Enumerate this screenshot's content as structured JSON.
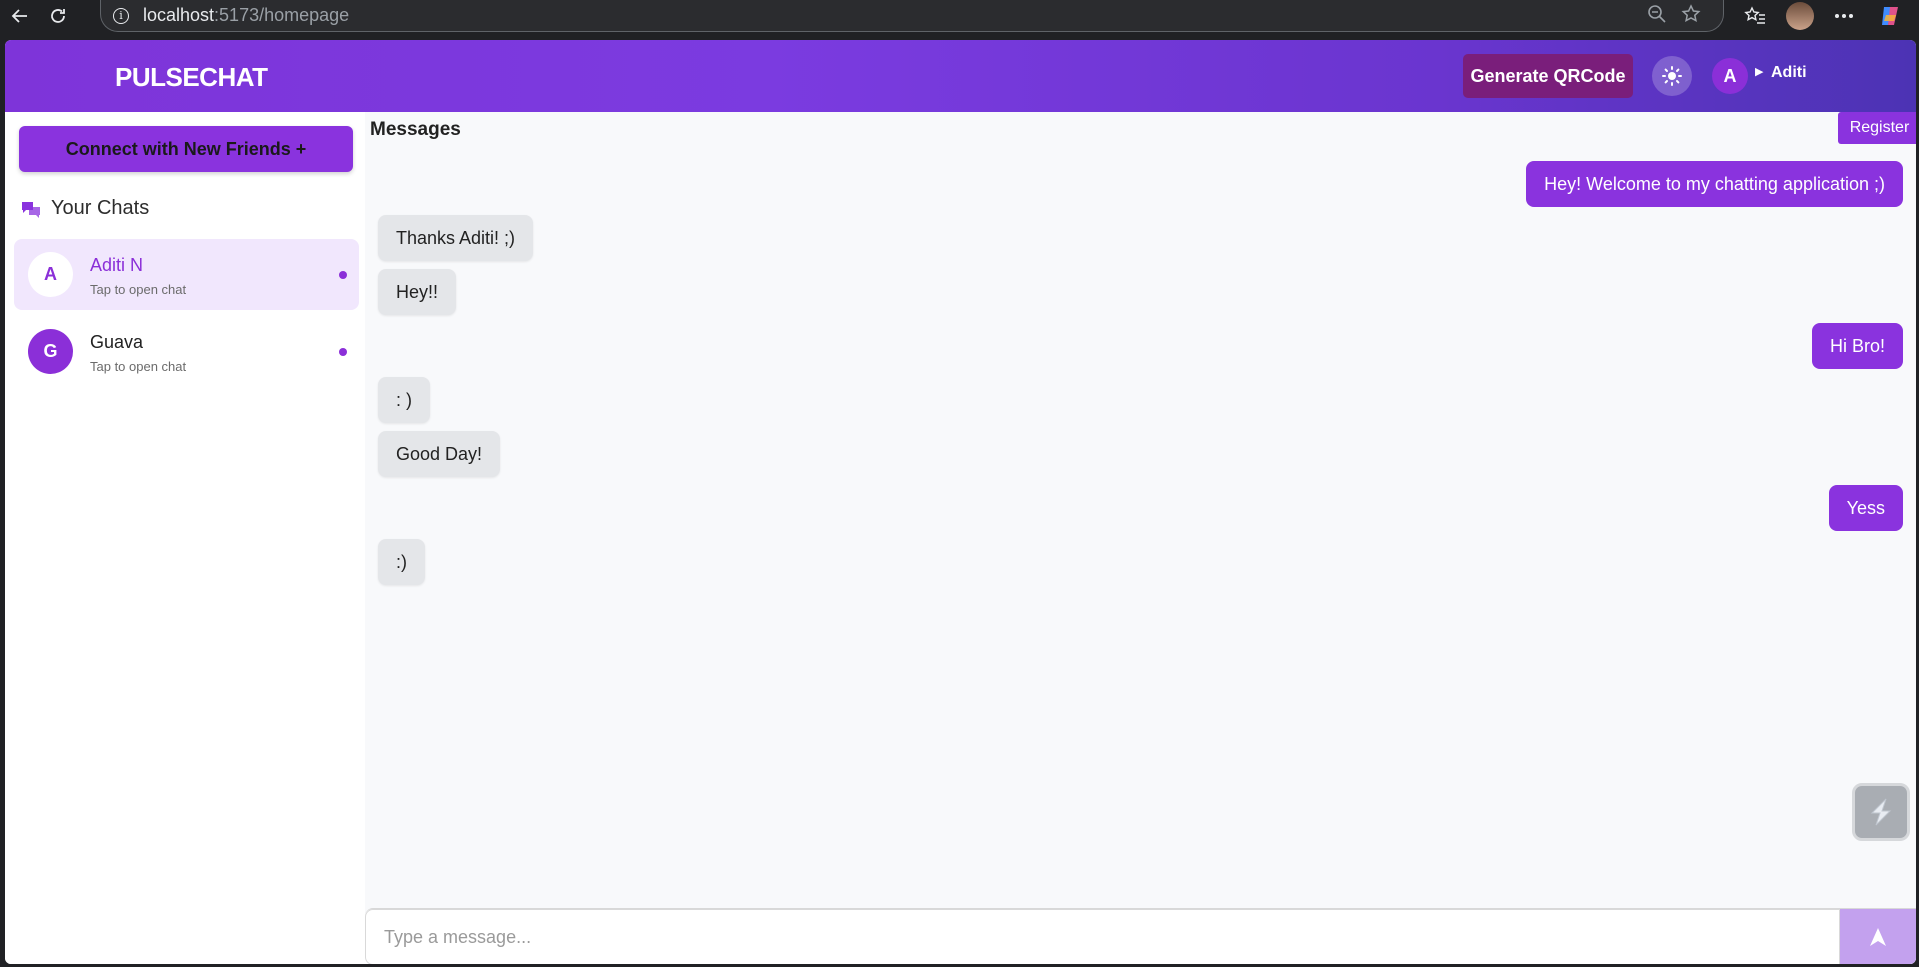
{
  "browser": {
    "url_host": "localhost",
    "url_path": ":5173/homepage",
    "icons": [
      "back-arrow-icon",
      "reload-icon",
      "info-icon",
      "zoom-out-icon",
      "star-icon",
      "favorites-icon",
      "profile-avatar",
      "more-icon",
      "copilot-icon"
    ]
  },
  "header": {
    "logo": "PULSECHAT",
    "qr_button": "Generate QRCode",
    "user_initial": "A",
    "user_name": "Aditi",
    "colors": {
      "gradient_start": "#7e34d9",
      "gradient_end": "#4c33b4",
      "qr_button": "#7a1e7b"
    }
  },
  "sidebar": {
    "connect_button": "Connect with New Friends  +",
    "chats_title": "Your Chats",
    "chats": [
      {
        "initial": "A",
        "name": "Aditi N",
        "subtitle": "Tap to open chat",
        "active": true
      },
      {
        "initial": "G",
        "name": "Guava",
        "subtitle": "Tap to open chat",
        "active": false
      }
    ]
  },
  "messages": {
    "title": "Messages",
    "register_button": "Register",
    "items": [
      {
        "text": "Hey! Welcome to my chatting application ;)",
        "direction": "out"
      },
      {
        "text": "Thanks Aditi! ;)",
        "direction": "in"
      },
      {
        "text": "Hey!!",
        "direction": "in"
      },
      {
        "text": "Hi Bro!",
        "direction": "out"
      },
      {
        "text": ": )",
        "direction": "in"
      },
      {
        "text": "Good Day!",
        "direction": "in"
      },
      {
        "text": "Yess",
        "direction": "out"
      },
      {
        "text": ":)",
        "direction": "in"
      }
    ],
    "input_placeholder": "Type a message...",
    "accent_color": "#8a33de"
  }
}
